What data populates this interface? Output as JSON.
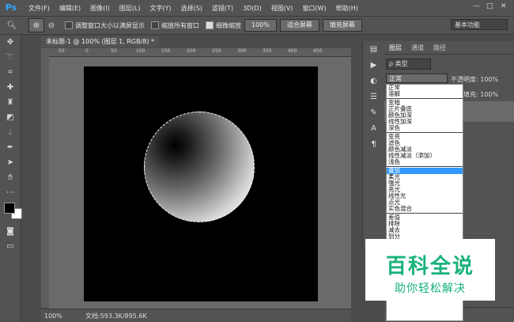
{
  "app": {
    "logo": "Ps"
  },
  "menu": [
    "文件(F)",
    "编辑(E)",
    "图像(I)",
    "图层(L)",
    "文字(Y)",
    "选择(S)",
    "滤镜(T)",
    "3D(D)",
    "视图(V)",
    "窗口(W)",
    "帮助(H)"
  ],
  "window_controls": {
    "minimize": "—",
    "maximize": "□",
    "close": "✕"
  },
  "options": {
    "resize_label": "调整窗口大小以满屏显示",
    "zoom_all_label": "缩放所有窗口",
    "scrubby_label": "细微缩放",
    "zoom_pct": "100%",
    "fit_screen": "适合屏幕",
    "fill_screen": "填充屏幕",
    "workspace": "基本功能"
  },
  "document": {
    "tab_title": "未标题-1 @ 100% (图层 1, RGB/8) *",
    "zoom": "100%",
    "doc_size": "文档:593.3K/895.6K",
    "ruler_ticks": [
      "50",
      "0",
      "50",
      "100",
      "150",
      "200",
      "250",
      "300",
      "350",
      "400",
      "450"
    ]
  },
  "layers_panel": {
    "tabs": [
      "图层",
      "通道",
      "路径"
    ],
    "kind": "ρ 类型",
    "blend_mode": "正常",
    "opacity_label": "不透明度: 100%",
    "fill_label": "填充: 100%"
  },
  "blend_menu": {
    "groups": [
      [
        "正常",
        "溶解"
      ],
      [
        "变暗",
        "正片叠底",
        "颜色加深",
        "线性加深",
        "深色"
      ],
      [
        "变亮",
        "滤色",
        "颜色减淡",
        "线性减淡（添加）",
        "浅色"
      ],
      [
        "叠加",
        "柔光",
        "强光",
        "亮光",
        "线性光",
        "点光",
        "实色混合"
      ],
      [
        "差值",
        "排除",
        "减去",
        "划分"
      ],
      [
        "色相",
        "饱和度",
        "颜色",
        "明度"
      ]
    ],
    "selected": "叠加"
  },
  "watermark": {
    "title": "百科全说",
    "subtitle": "助你轻松解决"
  },
  "colors": {
    "accent": "#31a8ff",
    "watermark": "#18b27a",
    "selection": "#3399ff"
  }
}
